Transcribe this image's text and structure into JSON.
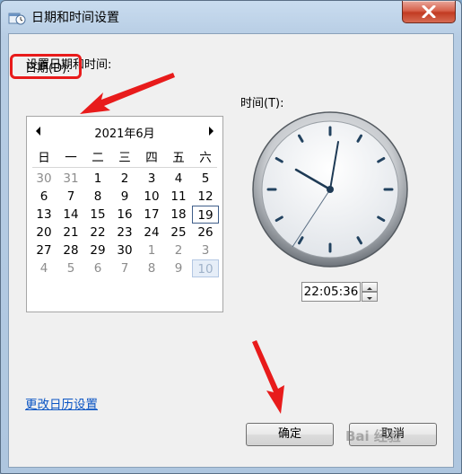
{
  "window": {
    "title": "日期和时间设置"
  },
  "heading": "设置日期和时间:",
  "date_label": "日期(D):",
  "time_label": "时间(T):",
  "calendar": {
    "month_title": "2021年6月",
    "weekdays": [
      "日",
      "一",
      "二",
      "三",
      "四",
      "五",
      "六"
    ],
    "weeks": [
      [
        "30",
        "31",
        "1",
        "2",
        "3",
        "4",
        "5"
      ],
      [
        "6",
        "7",
        "8",
        "9",
        "10",
        "11",
        "12"
      ],
      [
        "13",
        "14",
        "15",
        "16",
        "17",
        "18",
        "19"
      ],
      [
        "20",
        "21",
        "22",
        "23",
        "24",
        "25",
        "26"
      ],
      [
        "27",
        "28",
        "29",
        "30",
        "1",
        "2",
        "3"
      ],
      [
        "4",
        "5",
        "6",
        "7",
        "8",
        "9",
        "10"
      ]
    ]
  },
  "time_value": "22:05:36",
  "link_text": "更改日历设置",
  "ok_button": "确定",
  "cancel_button": "取消",
  "watermark": "Bai 经验",
  "colors": {
    "annotation_red": "#e81b1b",
    "link": "#0b55c4"
  }
}
